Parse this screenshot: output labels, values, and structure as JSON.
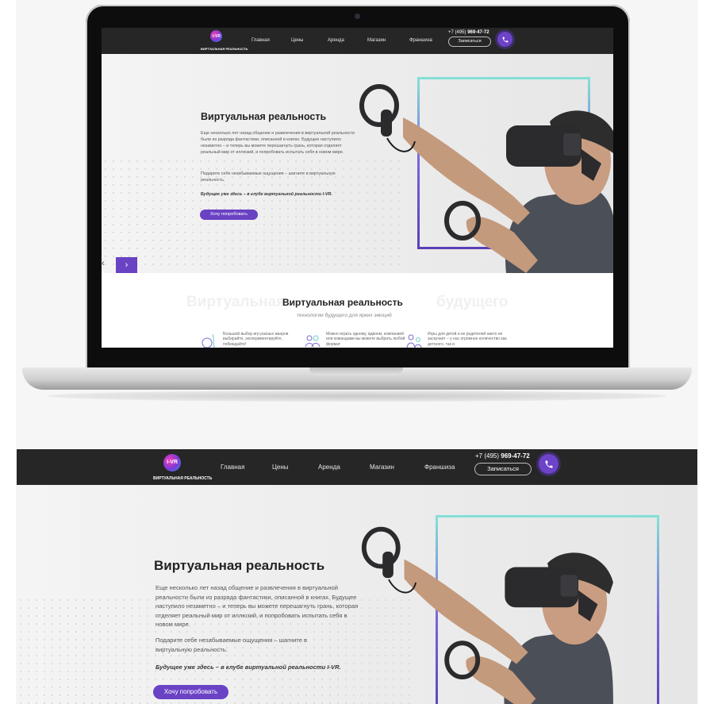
{
  "site": {
    "logo_mark": "I-VR",
    "logo_tagline": "Виртуальная реальность",
    "nav": [
      "Главная",
      "Цены",
      "Аренда",
      "Магазин",
      "Франшиза"
    ],
    "phone_prefix": "+7 (495)",
    "phone_number": "969-47-72",
    "signup_label": "Записаться"
  },
  "hero": {
    "title": "Виртуальная реальность",
    "paragraph1": "Еще несколько лет назад общение и развлечения в виртуальной реальности были из разряда фантастики, описанной в книгах. Будущее наступило незаметно – и теперь вы можете перешагнуть грань, которая отделяет реальный мир от иллюзий, и попробовать испытать себя в новом мире.",
    "paragraph2": "Подарите себе незабываемые ощущения – шагните в виртуальную реальность.",
    "slogan": "Будущее уже здесь – в клубе виртуальной реальности I-VR.",
    "cta_label": "Хочу попробовать",
    "prev_arrow": "‹",
    "next_arrow": "›"
  },
  "section2": {
    "ghost_left": "Виртуальная",
    "ghost_right": "будущего",
    "title": "Виртуальная реальность",
    "subtitle": "технологии будущего для ярких эмоций",
    "features": [
      {
        "icon": "bowling-icon",
        "text": "Большой выбор игр разных жанров выбирайте, экспериментируйте, побеждайте!"
      },
      {
        "icon": "group-icon",
        "text": "Можно играть одному, вдвоем, компанией или командами вы можете выбрать любой формат"
      },
      {
        "icon": "family-icon",
        "text": "Игры для детей и их родителей никто не заскучает – у нас огромное количество как детского, так и"
      }
    ]
  },
  "colors": {
    "accent": "#6a42c4",
    "header_bg": "#262626",
    "frame_top": "#84e0d7",
    "frame_bottom": "#5a3fb7"
  }
}
